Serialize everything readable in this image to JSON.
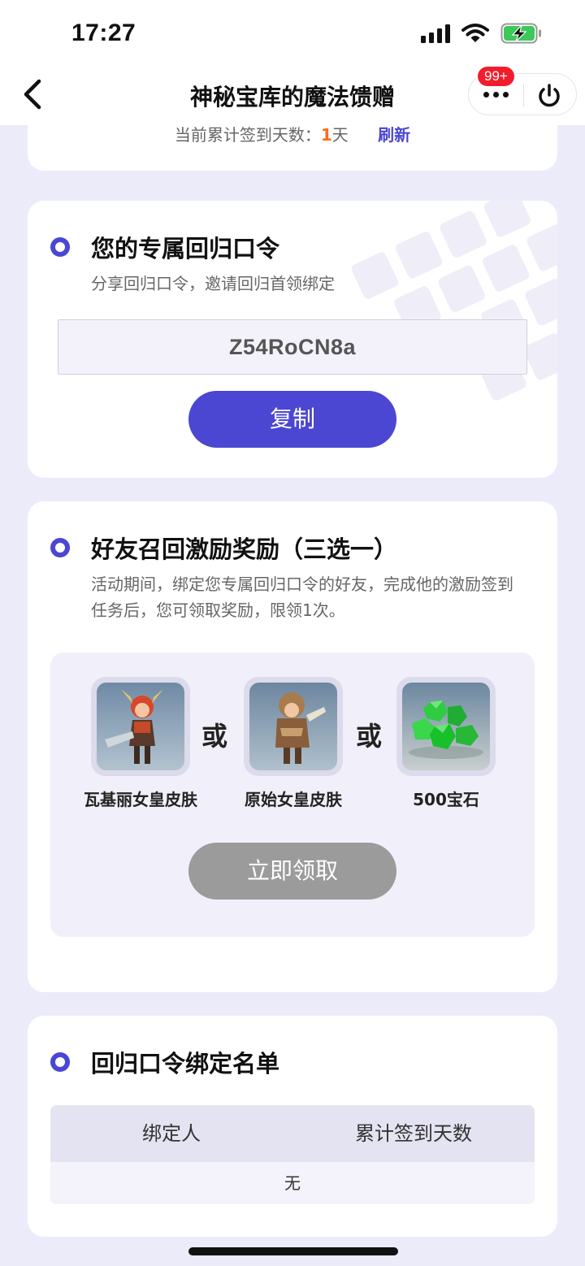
{
  "status_bar": {
    "time": "17:27"
  },
  "nav": {
    "title": "神秘宝库的魔法馈赠",
    "badge": "99+"
  },
  "signin": {
    "prefix": "当前累计签到天数：",
    "days": "1",
    "suffix": "天",
    "refresh": "刷新"
  },
  "code_card": {
    "title": "您的专属回归口令",
    "desc": "分享回归口令，邀请回归首领绑定",
    "code": "Z54RoCN8a",
    "copy_label": "复制"
  },
  "reward_card": {
    "title": "好友召回激励奖励（三选一）",
    "desc": "活动期间，绑定您专属回归口令的好友，完成他的激励签到任务后，您可领取奖励，限领1次。",
    "or_label": "或",
    "items": [
      {
        "label": "瓦基丽女皇皮肤"
      },
      {
        "label": "原始女皇皮肤"
      },
      {
        "label": "500宝石"
      }
    ],
    "claim_label": "立即领取"
  },
  "bind_card": {
    "title": "回归口令绑定名单",
    "columns": [
      "绑定人",
      "累计签到天数"
    ],
    "empty": "无"
  },
  "colors": {
    "accent": "#4b47d2",
    "highlight": "#ff6a1a",
    "disabled": "#9b9b9b",
    "badge": "#f21d2b"
  }
}
